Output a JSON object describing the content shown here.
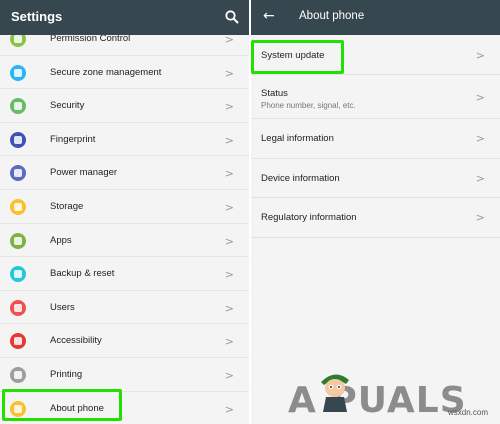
{
  "left": {
    "title": "Settings",
    "items": [
      {
        "label": "Permission Control",
        "icon": "permission-icon",
        "color": "#8bc34a"
      },
      {
        "label": "Secure zone management",
        "icon": "secure-zone-icon",
        "color": "#29b6f6"
      },
      {
        "label": "Security",
        "icon": "security-icon",
        "color": "#66bb6a"
      },
      {
        "label": "Fingerprint",
        "icon": "fingerprint-icon",
        "color": "#3f51b5"
      },
      {
        "label": "Power manager",
        "icon": "power-icon",
        "color": "#5c6bc0"
      },
      {
        "label": "Storage",
        "icon": "storage-icon",
        "color": "#fbc02d"
      },
      {
        "label": "Apps",
        "icon": "apps-icon",
        "color": "#7cb342"
      },
      {
        "label": "Backup & reset",
        "icon": "backup-icon",
        "color": "#26c6da"
      },
      {
        "label": "Users",
        "icon": "users-icon",
        "color": "#ef5350"
      },
      {
        "label": "Accessibility",
        "icon": "accessibility-icon",
        "color": "#e53935"
      },
      {
        "label": "Printing",
        "icon": "printing-icon",
        "color": "#9e9e9e"
      },
      {
        "label": "About phone",
        "icon": "info-icon",
        "color": "#fbc02d"
      }
    ],
    "chevron": ">"
  },
  "right": {
    "title": "About phone",
    "items": [
      {
        "label": "System update",
        "sub": ""
      },
      {
        "label": "Status",
        "sub": "Phone number, signal, etc."
      },
      {
        "label": "Legal information",
        "sub": ""
      },
      {
        "label": "Device information",
        "sub": ""
      },
      {
        "label": "Regulatory information",
        "sub": ""
      }
    ]
  },
  "branding": {
    "logo": "A PUALS",
    "watermark": "wsxdn.com"
  },
  "colors": {
    "appbar": "#37474f",
    "highlight": "#22e000",
    "background": "#f4f4f4"
  }
}
